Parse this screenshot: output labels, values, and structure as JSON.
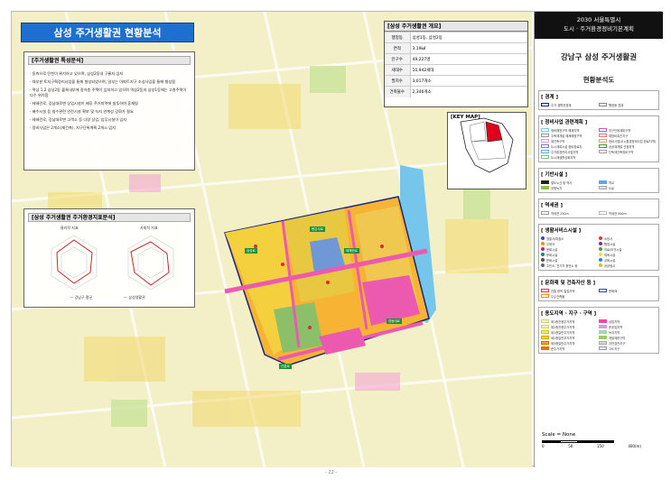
{
  "page_number": "- 22 -",
  "map_title": "삼성 주거생활권 현황분석",
  "features": {
    "heading": "[주거생활권 특성분석]",
    "items": [
      "· 동측으로 탄천이 위치하고 있으며, 삼성2동내 구룡지 입지",
      "· 대부분 토지구획정리사업을 통해 형성되었으며, 일부는 아파트지구 조성사업을 통해 형성됨",
      "· 역삼 1,2 삼성2동 블록내부에 중저층 주택이 입지하고 있으며 역삼2동과 삼성1동에는 고층주택이 다수 위치함",
      "· 테헤란로, 강남대로변 상업시설이 배후 주거지역에 침투하여 혼재됨",
      "· 배수시설 등 침수관련 안전시설 확보 및 녹지 연계성 강화가 필요",
      "· 테헤란로, 강남대로변 고객소 등 다량 상업, 업무시설이 입지",
      "· 정비사업은 2개소(재건축), 지구단위계획 2개소 입지"
    ]
  },
  "indicators": {
    "heading": "[삼성 주거생활권 주거환경지표분석]",
    "radar1_title": "물리적 지표",
    "radar2_title": "사회적 지표",
    "legend1": "--- 강남구 평균",
    "legend2": "— 삼성생활권"
  },
  "overview": {
    "heading": "[삼성 주거생활권 개요]",
    "rows": [
      [
        "행정동",
        "삼성1동, 삼성2동"
      ],
      [
        "면적",
        "3.19㎢"
      ],
      [
        "인구수",
        "49,227명"
      ],
      [
        "세대수",
        "10,942세대"
      ],
      [
        "필지수",
        "3,017개소"
      ],
      [
        "건축물수",
        "2,346개소"
      ]
    ]
  },
  "keymap": {
    "heading": "[KEY MAP]"
  },
  "roads": [
    "봉은사로",
    "테헤란로",
    "삼성로",
    "영동대로",
    "선릉로"
  ],
  "sidebar": {
    "top_line1": "2030 서울특별시",
    "top_line2": "도시 · 주거환경정비기본계획",
    "area_title": "강남구 삼성 주거생활권",
    "map_type": "현황분석도",
    "sections": [
      {
        "title": "[ 경계 ]",
        "items": [
          {
            "label": "주거 생활권경계",
            "color": "#ffffff",
            "border": "#1a237e"
          },
          {
            "label": "행정동 경계",
            "color": "#ffffff",
            "border": "#888888"
          }
        ]
      },
      {
        "title": "[ 정비사업 관련계획 ]",
        "items": [
          {
            "label": "정비예정구역 해제지역",
            "color": "#ffffff",
            "border": "#7ad0e0"
          },
          {
            "label": "지구단위계획구역",
            "color": "#ffffff",
            "border": "#c060c0"
          },
          {
            "label": "주택재개발 해제예정구역",
            "color": "#ffffff",
            "border": "#999999"
          },
          {
            "label": "재정비촉진지구",
            "color": "#ffffff",
            "border": "#e08080"
          },
          {
            "label": "재건축구역",
            "color": "#ffffff",
            "border": "#d9a0d9"
          },
          {
            "label": "정비사업(도시환경정비사업 완료지역)",
            "color": "#ffffff",
            "border": "#f0a060"
          },
          {
            "label": "도시계획시설 정비완료지",
            "color": "#ffffff",
            "border": "#8080c0"
          },
          {
            "label": "공공재개발 선정지역",
            "color": "#ffffff",
            "border": "#40a040"
          },
          {
            "label": "주거환경관리사업지역",
            "color": "#ffffff",
            "border": "#60b0e0"
          },
          {
            "label": "단독재건축정비구역",
            "color": "#ffffff",
            "border": "#a0a0a0"
          },
          {
            "label": "도시재생활성화지역",
            "color": "#ffffff",
            "border": "#80c080"
          }
        ]
      },
      {
        "title": "[ 기반시설 ]",
        "items": [
          {
            "label": "철도노선 및 역사",
            "color": "#222222",
            "border": "#222222"
          },
          {
            "label": "학교",
            "color": "#5aa9e6",
            "border": "#5aa9e6"
          },
          {
            "label": "공원녹지",
            "color": "#8bc34a",
            "border": "#8bc34a"
          },
          {
            "label": "도로",
            "color": "#dddddd",
            "border": "#aaaaaa"
          }
        ]
      },
      {
        "title": "[ 역세권 ]",
        "items": [
          {
            "label": "역세권 250m",
            "color": "#ffffff",
            "border": "#999999"
          },
          {
            "label": "역세권 500m",
            "color": "#ffffff",
            "border": "#bbbbbb"
          }
        ]
      },
      {
        "title": "[ 생활서비스시설 ]",
        "dots": [
          {
            "label": "경찰서/파출소",
            "color": "#3949ab"
          },
          {
            "label": "소방서",
            "color": "#e53935"
          },
          {
            "label": "우체국",
            "color": "#fb8c00"
          },
          {
            "label": "행정시설",
            "color": "#8e24aa"
          },
          {
            "label": "문화시설",
            "color": "#d81b60"
          },
          {
            "label": "의료/보건시설",
            "color": "#43a047"
          },
          {
            "label": "문화시설",
            "color": "#00897b"
          },
          {
            "label": "체육시설",
            "color": "#fdd835"
          },
          {
            "label": "문화시설",
            "color": "#6d4c41"
          },
          {
            "label": "교육시설",
            "color": "#1e88e5"
          },
          {
            "label": "주민소, 전기차 충전소 등",
            "color": "#546e7a"
          },
          {
            "label": "공공청사",
            "color": "#c0ca33"
          }
        ]
      },
      {
        "title": "[ 문화재 및 건축자산 등 ]",
        "items": [
          {
            "label": "전통 한옥 밀집지역",
            "color": "#ffffff",
            "border": "#e53935"
          },
          {
            "label": "문화재",
            "color": "#ffffff",
            "border": "#3949ab"
          },
          {
            "label": "우수건축물",
            "color": "#ffffff",
            "border": "#fb8c00"
          }
        ]
      },
      {
        "title": "[ 용도지역 · 지구 · 구역 ]",
        "items": [
          {
            "label": "제1종전용주거지역",
            "color": "#fff9c4",
            "border": "#cccc88"
          },
          {
            "label": "상업지역",
            "color": "#ec4ba0",
            "border": "#ec4ba0"
          },
          {
            "label": "제2종전용주거지역",
            "color": "#fff59d",
            "border": "#cccc88"
          },
          {
            "label": "준공업지역",
            "color": "#c7a0e8",
            "border": "#c7a0e8"
          },
          {
            "label": "제1종일반주거지역",
            "color": "#ffee58",
            "border": "#c8c030"
          },
          {
            "label": "녹지지역",
            "color": "#a5d6a7",
            "border": "#a5d6a7"
          },
          {
            "label": "제2종일반주거지역",
            "color": "#fdd835",
            "border": "#c8a800"
          },
          {
            "label": "개발제한구역",
            "color": "#9ccc65",
            "border": "#9ccc65"
          },
          {
            "label": "제3종일반주거지역",
            "color": "#f9a825",
            "border": "#c07800"
          },
          {
            "label": "자연경관지구",
            "color": "#cfd8dc",
            "border": "#aaaaaa"
          },
          {
            "label": "준주거지역",
            "color": "#ef6c00",
            "border": "#ef6c00"
          },
          {
            "label": "고도지구",
            "color": "#eeeeee",
            "border": "#999999"
          }
        ]
      }
    ],
    "scale_label": "Scale = None",
    "scale_ticks": [
      "0",
      "50",
      "150",
      "400(m)"
    ]
  }
}
